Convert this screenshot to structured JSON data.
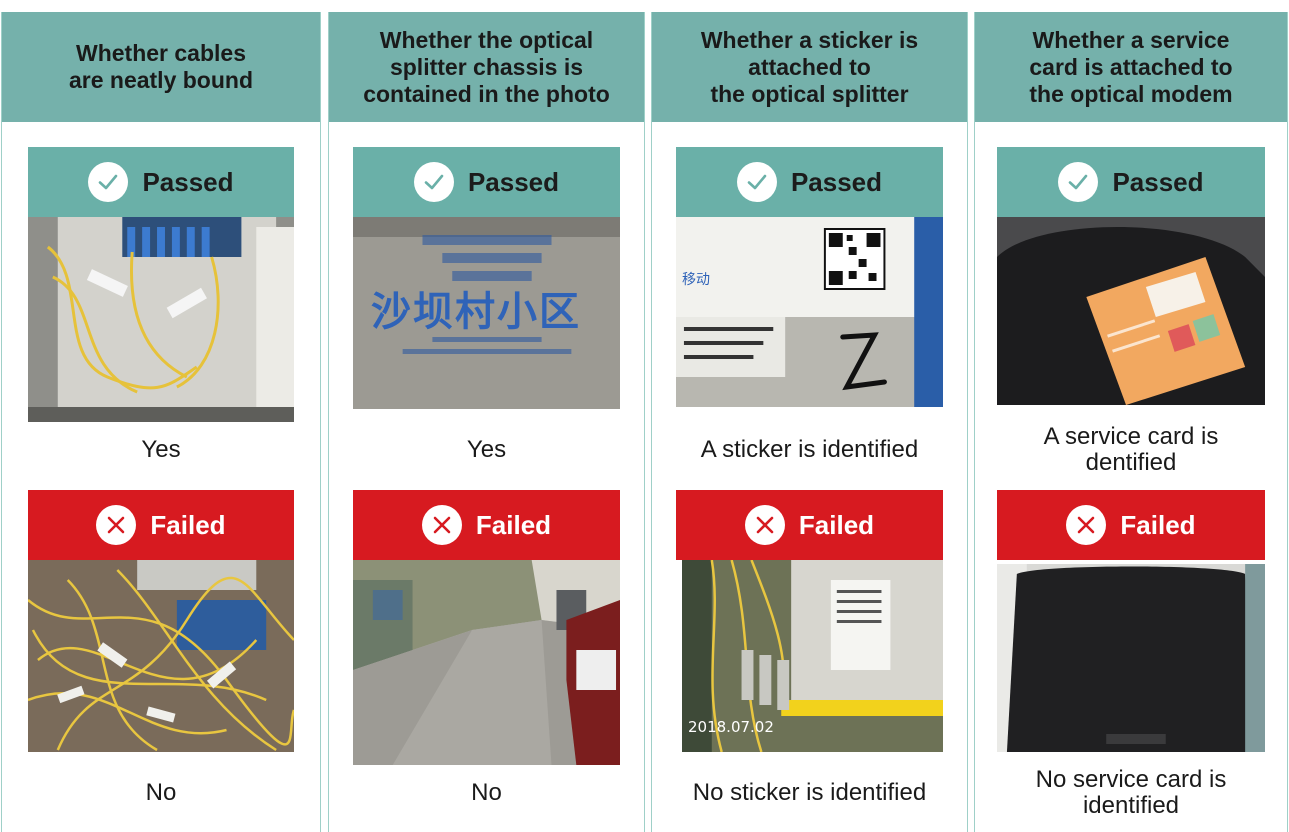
{
  "columns": [
    {
      "header": "Whether cables\nare neatly bound",
      "passed": {
        "label": "Passed",
        "caption": "Yes"
      },
      "failed": {
        "label": "Failed",
        "caption": "No"
      }
    },
    {
      "header": "Whether the optical\nsplitter chassis is\ncontained in the photo",
      "passed": {
        "label": "Passed",
        "caption": "Yes",
        "photo_text": "沙坝村小区"
      },
      "failed": {
        "label": "Failed",
        "caption": "No"
      }
    },
    {
      "header": "Whether a sticker is\nattached to\nthe optical splitter",
      "passed": {
        "label": "Passed",
        "caption": "A sticker is identified",
        "photo_text": "移动"
      },
      "failed": {
        "label": "Failed",
        "caption": "No sticker is identified",
        "photo_text": "2018.07.02"
      }
    },
    {
      "header": "Whether a service\ncard is attached to\nthe optical modem",
      "passed": {
        "label": "Passed",
        "caption": "A service card is\ndentified"
      },
      "failed": {
        "label": "Failed",
        "caption": "No service card is\nidentified"
      }
    }
  ],
  "colors": {
    "header": "#75b1ab",
    "passed": "#6ab0a8",
    "failed": "#d71a20",
    "divider": "#9fd0c8"
  },
  "icons": {
    "passed": "check-circle-icon",
    "failed": "x-circle-icon"
  }
}
